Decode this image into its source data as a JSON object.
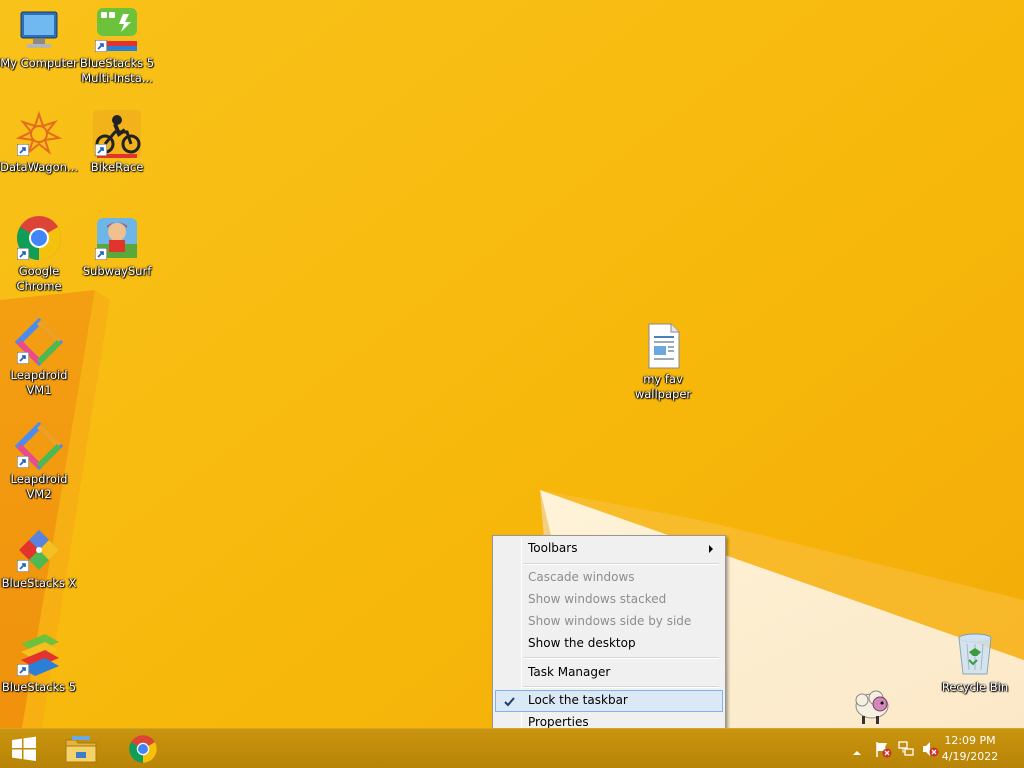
{
  "desktop": {
    "icons": [
      {
        "label": "My Computer",
        "icon": "computer-icon"
      },
      {
        "label": "BlueStacks 5\nMulti-Insta...",
        "icon": "bluestacks-multi-instance-icon"
      },
      {
        "label": "DataWagon...",
        "icon": "datawagon-icon"
      },
      {
        "label": "BikeRace",
        "icon": "bikerace-icon"
      },
      {
        "label": "Google\nChrome",
        "icon": "chrome-icon"
      },
      {
        "label": "SubwaySurf",
        "icon": "subwaysurf-icon"
      },
      {
        "label": "Leapdroid\nVM1",
        "icon": "leapdroid-icon"
      },
      {
        "label": "Leapdroid\nVM2",
        "icon": "leapdroid-icon"
      },
      {
        "label": "BlueStacks X",
        "icon": "bluestacks-x-icon"
      },
      {
        "label": "BlueStacks 5",
        "icon": "bluestacks-icon"
      },
      {
        "label": "my fav\nwallpaper",
        "icon": "document-icon"
      },
      {
        "label": "Recycle Bin",
        "icon": "recycle-bin-icon"
      }
    ]
  },
  "context_menu": {
    "toolbars": "Toolbars",
    "cascade": "Cascade windows",
    "stacked": "Show windows stacked",
    "side_by_side": "Show windows side by side",
    "show_desktop": "Show the desktop",
    "task_manager": "Task Manager",
    "lock_taskbar": "Lock the taskbar",
    "lock_checked": true,
    "properties": "Properties"
  },
  "taskbar": {
    "pinned": [
      "start-button",
      "file-explorer-icon",
      "chrome-icon"
    ],
    "tray_icons": [
      "show-hidden-icons-arrow",
      "action-center-flag-icon",
      "network-icon",
      "volume-muted-icon"
    ],
    "time": "12:09 PM",
    "date": "4/19/2022"
  },
  "colors": {
    "wallpaper": "#f7b90c",
    "taskbar": "#c08a0c",
    "menu_highlight": "#dbe8f5",
    "menu_highlight_border": "#7eb4ea"
  }
}
